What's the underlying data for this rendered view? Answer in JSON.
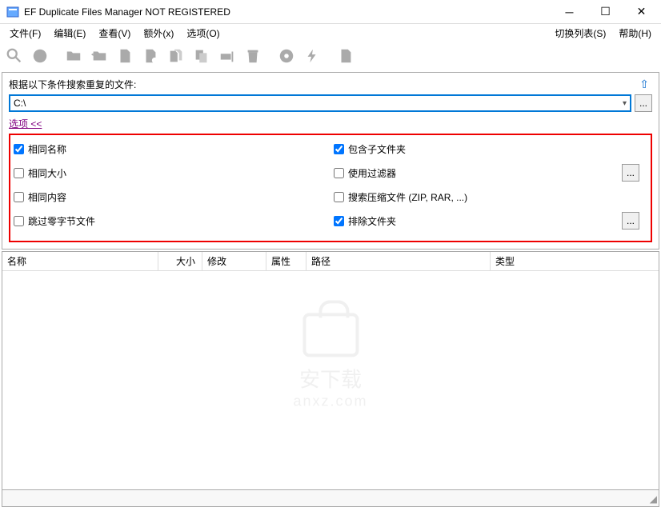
{
  "window": {
    "title": "EF Duplicate Files Manager NOT REGISTERED"
  },
  "menu": {
    "file": "文件(F)",
    "edit": "编辑(E)",
    "view": "查看(V)",
    "extra": "额外(x)",
    "options": "选项(O)",
    "switch_list": "切换列表(S)",
    "help": "帮助(H)"
  },
  "search": {
    "label": "根据以下条件搜索重复的文件:",
    "path": "C:\\",
    "options_link": "选项 <<"
  },
  "checks": {
    "same_name": "相同名称",
    "same_size": "相同大小",
    "same_content": "相同内容",
    "skip_zero": "跳过零字节文件",
    "include_sub": "包含子文件夹",
    "use_filter": "使用过滤器",
    "search_archive": "搜索压缩文件 (ZIP, RAR, ...)",
    "exclude_folder": "排除文件夹"
  },
  "columns": {
    "name": "名称",
    "size": "大小",
    "modified": "修改",
    "attr": "属性",
    "path": "路径",
    "type": "类型"
  },
  "watermark": {
    "text": "安下载",
    "sub": "anxz.com"
  },
  "ellipsis": "..."
}
